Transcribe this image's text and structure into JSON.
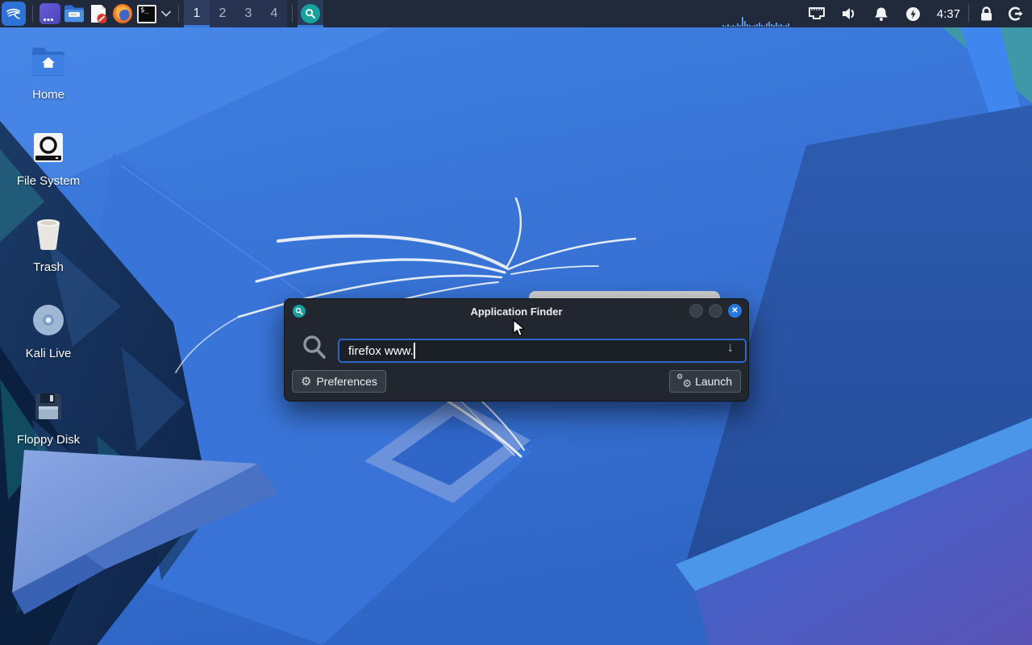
{
  "colors": {
    "accent_blue": "#2e72d8",
    "panel_bg": "#212a3b",
    "dialog_bg": "#22262e",
    "input_border": "#2b66c9",
    "close_button": "#2478e0",
    "appfinder_teal": "#17a2a0",
    "wallpaper_base": "#2f6fd4"
  },
  "panel": {
    "launchers": [
      {
        "icon": "kali-menu-icon"
      },
      {
        "icon": "purple-app-icon"
      },
      {
        "icon": "file-manager-icon"
      },
      {
        "icon": "text-editor-icon"
      },
      {
        "icon": "firefox-icon"
      },
      {
        "icon": "terminal-icon",
        "has_dropdown": true
      }
    ],
    "workspaces": {
      "items": [
        "1",
        "2",
        "3",
        "4"
      ],
      "active": "1"
    },
    "taskbar": [
      {
        "icon": "application-finder-icon",
        "active": true
      }
    ],
    "network_graph": {
      "bars": [
        2,
        1,
        3,
        1,
        2,
        1,
        4,
        2,
        12,
        7,
        3,
        2,
        1,
        2,
        3,
        5,
        2,
        1,
        4,
        6,
        3,
        2,
        5,
        2,
        3,
        1,
        2,
        4
      ]
    },
    "tray_icons": [
      "ethernet-icon",
      "volume-icon",
      "notifications-bell-icon",
      "power-manager-icon"
    ],
    "clock": "4:37",
    "session_icons": [
      "lock-icon",
      "logout-icon"
    ]
  },
  "desktop": {
    "icons": [
      {
        "label": "Home",
        "icon": "home-folder-icon"
      },
      {
        "label": "File System",
        "icon": "filesystem-drive-icon"
      },
      {
        "label": "Trash",
        "icon": "trash-icon"
      },
      {
        "label": "Kali Live",
        "icon": "disc-icon"
      },
      {
        "label": "Floppy Disk",
        "icon": "floppy-icon"
      }
    ]
  },
  "dialog": {
    "title": "Application Finder",
    "window_controls": [
      "minimize",
      "maximize",
      "close"
    ],
    "close_glyph": "✕",
    "search": {
      "value": "firefox www.",
      "combo_arrow": "↓"
    },
    "preferences_label": "Preferences",
    "launch_label": "Launch",
    "gear_glyph": "⚙"
  }
}
